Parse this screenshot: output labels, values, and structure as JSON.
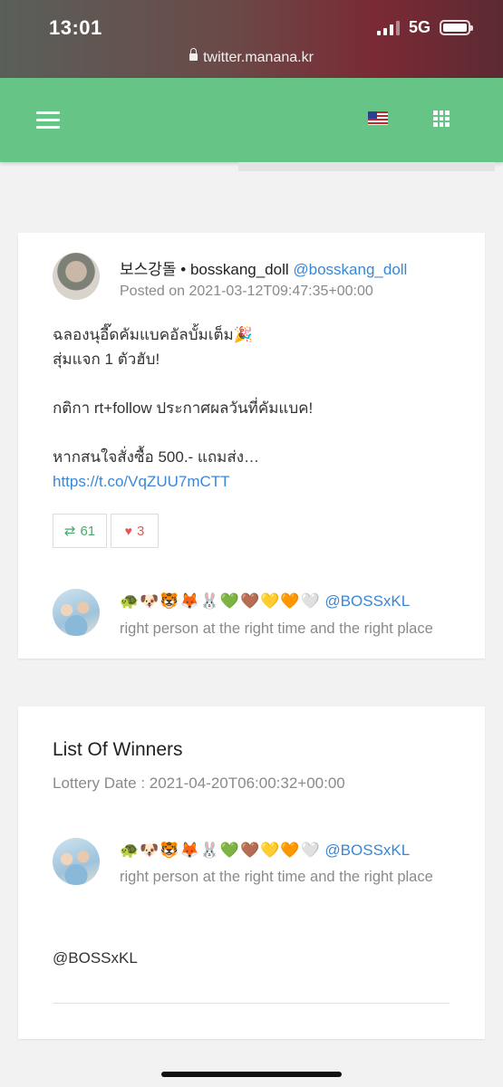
{
  "status_bar": {
    "time": "13:01",
    "network": "5G"
  },
  "browser": {
    "url": "twitter.manana.kr"
  },
  "navbar": {
    "menu_icon": "hamburger-menu-icon",
    "language_icon": "us-flag-icon",
    "apps_icon": "grid-icon"
  },
  "tweet": {
    "author_name": "보스강돌 • bosskang_doll",
    "author_handle": "@bosskang_doll",
    "posted": "Posted on 2021-03-12T09:47:35+00:00",
    "lines": [
      "ฉลองนุอี๊ดคัมแบคอัลบั้มเต็ม🎉",
      "สุ่มแจก 1 ตัวฮับ!",
      "",
      "กติกา rt+follow ประกาศผลวันที่คัมแบค!",
      "",
      "หากสนใจสั่งซื้อ 500.- แถมส่ง…"
    ],
    "link": "https://t.co/VqZUU7mCTT",
    "retweets": "61",
    "likes": "3",
    "colors": {
      "link": "#3b87d6",
      "retweet": "#4aa86b",
      "like": "#e05a5a"
    }
  },
  "participant": {
    "emoji_name": "🐢🐶🐯🦊🐰💚🤎💛🧡🤍",
    "handle": "@BOSSxKL",
    "bio": "right person at the right time and the right place"
  },
  "winners": {
    "title": "List Of Winners",
    "lottery_date": "Lottery Date : 2021-04-20T06:00:32+00:00",
    "winner": {
      "emoji_name": "🐢🐶🐯🦊🐰💚🤎💛🧡🤍",
      "handle": "@BOSSxKL",
      "bio": "right person at the right time and the right place"
    },
    "winner_handle_text": "@BOSSxKL"
  },
  "theme": {
    "header_green": "#66c487",
    "background": "#f2f2f2"
  }
}
